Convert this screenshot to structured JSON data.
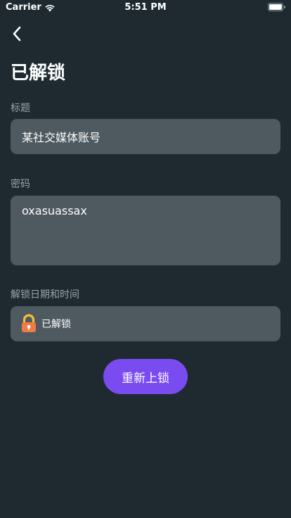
{
  "status_bar": {
    "carrier": "Carrier",
    "time": "5:51 PM"
  },
  "header": {
    "title": "已解锁"
  },
  "form": {
    "title_label": "标题",
    "title_value": "某社交媒体账号",
    "password_label": "密码",
    "password_value": "oxasuassax",
    "unlock_label": "解锁日期和时间",
    "unlock_status": "已解锁"
  },
  "actions": {
    "relock_label": "重新上锁"
  },
  "colors": {
    "background": "#1e2a30",
    "field": "#4f5a60",
    "accent": "#7a4cf0",
    "label": "#9aa5ab",
    "lock_body": "#f07c45",
    "lock_shackle": "#f5c035"
  },
  "icons": {
    "back": "chevron-left-icon",
    "wifi": "wifi-icon",
    "battery": "battery-icon",
    "lock": "unlocked-padlock-icon"
  }
}
